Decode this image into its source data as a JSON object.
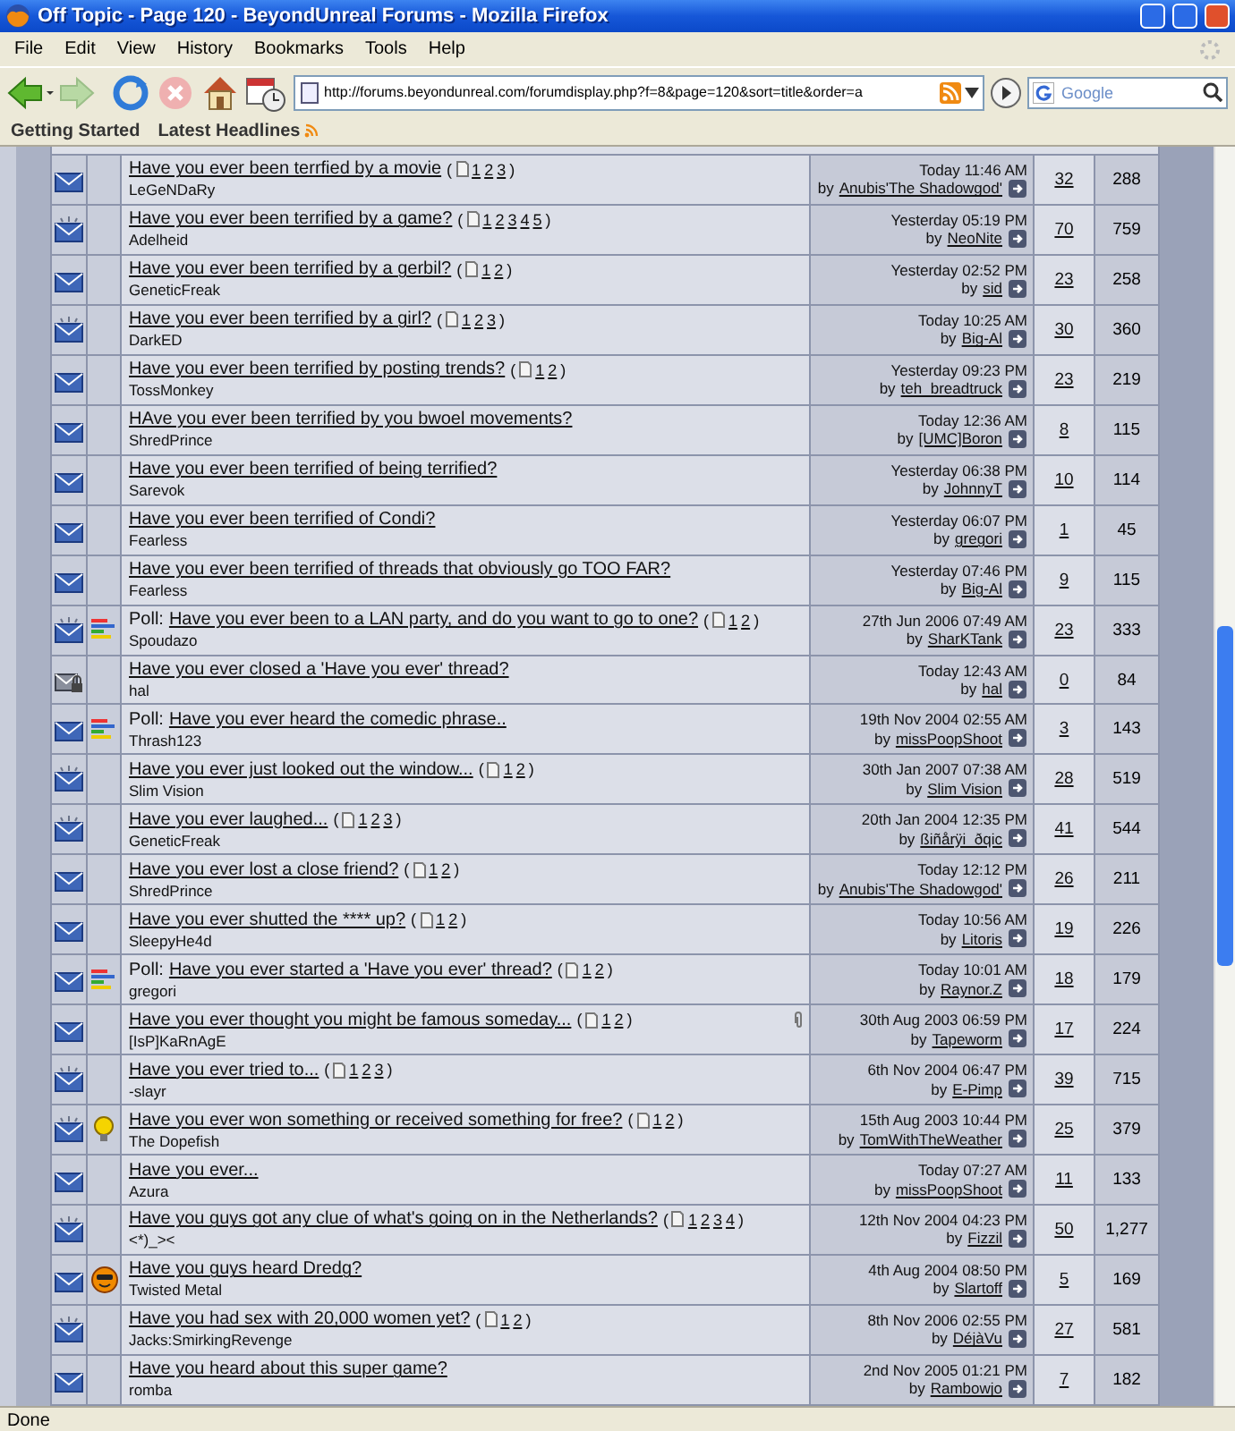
{
  "window": {
    "title": "Off Topic - Page 120 - BeyondUnreal Forums - Mozilla Firefox"
  },
  "menu": [
    "File",
    "Edit",
    "View",
    "History",
    "Bookmarks",
    "Tools",
    "Help"
  ],
  "toolbar": {
    "forward_enabled": false,
    "stop_enabled": false
  },
  "address": {
    "value": "http://forums.beyondunreal.com/forumdisplay.php?f=8&page=120&sort=title&order=a"
  },
  "search": {
    "placeholder": "Google"
  },
  "bookmarks": [
    {
      "label": "Getting Started",
      "kind": "link"
    },
    {
      "label": "Latest Headlines",
      "kind": "feed"
    }
  ],
  "threads": [
    {
      "status": {
        "kind": "normal"
      },
      "title": "Have you ever been terrfied by a movie",
      "pages": {
        "open": "(",
        "numbers": [
          "1",
          "2",
          "3"
        ],
        "close": ")"
      },
      "attachment": false,
      "starter": "LeGeNDaRy",
      "date": "Today 11:46 AM",
      "by": "by",
      "last_poster": "Anubis'The Shadowgod'",
      "replies": "32",
      "views": "288"
    },
    {
      "status": {
        "kind": "hot"
      },
      "title": "Have you ever been terrified by a game?",
      "pages": {
        "open": "(",
        "numbers": [
          "1",
          "2",
          "3",
          "4",
          "5"
        ],
        "close": ")"
      },
      "attachment": false,
      "starter": "Adelheid",
      "date": "Yesterday 05:19 PM",
      "by": "by",
      "last_poster": "NeoNite",
      "replies": "70",
      "views": "759"
    },
    {
      "status": {
        "kind": "normal"
      },
      "title": "Have you ever been terrified by a gerbil?",
      "pages": {
        "open": "(",
        "numbers": [
          "1",
          "2"
        ],
        "close": ")"
      },
      "attachment": false,
      "starter": "GeneticFreak",
      "date": "Yesterday 02:52 PM",
      "by": "by",
      "last_poster": "sid",
      "replies": "23",
      "views": "258"
    },
    {
      "status": {
        "kind": "hot"
      },
      "title": "Have you ever been terrified by a girl?",
      "pages": {
        "open": "(",
        "numbers": [
          "1",
          "2",
          "3"
        ],
        "close": ")"
      },
      "attachment": false,
      "starter": "DarkED",
      "date": "Today 10:25 AM",
      "by": "by",
      "last_poster": "Big-Al",
      "replies": "30",
      "views": "360"
    },
    {
      "status": {
        "kind": "normal"
      },
      "title": "Have you ever been terrified by posting trends?",
      "pages": {
        "open": "(",
        "numbers": [
          "1",
          "2"
        ],
        "close": ")"
      },
      "attachment": false,
      "starter": "TossMonkey",
      "date": "Yesterday 09:23 PM",
      "by": "by",
      "last_poster": "teh_breadtruck",
      "replies": "23",
      "views": "219"
    },
    {
      "status": {
        "kind": "normal"
      },
      "title": "HAve you ever been terrified by you bwoel movements?",
      "attachment": false,
      "starter": "ShredPrince",
      "date": "Today 12:36 AM",
      "by": "by",
      "last_poster": "[UMC]Boron",
      "replies": "8",
      "views": "115"
    },
    {
      "status": {
        "kind": "normal"
      },
      "title": "Have you ever been terrified of being terrified?",
      "attachment": false,
      "starter": "Sarevok",
      "date": "Yesterday 06:38 PM",
      "by": "by",
      "last_poster": "JohnnyT",
      "replies": "10",
      "views": "114"
    },
    {
      "status": {
        "kind": "normal"
      },
      "title": "Have you ever been terrified of Condi?",
      "attachment": false,
      "starter": "Fearless",
      "date": "Yesterday 06:07 PM",
      "by": "by",
      "last_poster": "gregori",
      "replies": "1",
      "views": "45"
    },
    {
      "status": {
        "kind": "normal"
      },
      "title": "Have you ever been terrified of threads that obviously go TOO FAR?",
      "attachment": false,
      "starter": "Fearless",
      "date": "Yesterday 07:46 PM",
      "by": "by",
      "last_poster": "Big-Al",
      "replies": "9",
      "views": "115"
    },
    {
      "status": {
        "kind": "hot"
      },
      "post_icon": {
        "kind": "poll"
      },
      "prefix": "Poll:",
      "title": "Have you ever been to a LAN party, and do you want to go to one?",
      "pages": {
        "open": "(",
        "numbers": [
          "1",
          "2"
        ],
        "close": ")"
      },
      "attachment": false,
      "starter": "Spoudazo",
      "date": "27th Jun 2006 07:49 AM",
      "by": "by",
      "last_poster": "SharKTank",
      "replies": "23",
      "views": "333"
    },
    {
      "status": {
        "kind": "locked"
      },
      "title": "Have you ever closed a 'Have you ever' thread?",
      "attachment": false,
      "starter": "hal",
      "date": "Today 12:43 AM",
      "by": "by",
      "last_poster": "hal",
      "replies": "0",
      "views": "84"
    },
    {
      "status": {
        "kind": "normal"
      },
      "post_icon": {
        "kind": "poll"
      },
      "prefix": "Poll:",
      "title": "Have you ever heard the comedic phrase..",
      "attachment": false,
      "starter": "Thrash123",
      "date": "19th Nov 2004 02:55 AM",
      "by": "by",
      "last_poster": "missPoopShoot",
      "replies": "3",
      "views": "143"
    },
    {
      "status": {
        "kind": "hot"
      },
      "title": "Have you ever just looked out the window...",
      "pages": {
        "open": "(",
        "numbers": [
          "1",
          "2"
        ],
        "close": ")"
      },
      "attachment": false,
      "starter": "Slim Vision",
      "date": "30th Jan 2007 07:38 AM",
      "by": "by",
      "last_poster": "Slim Vision",
      "replies": "28",
      "views": "519"
    },
    {
      "status": {
        "kind": "hot"
      },
      "title": "Have you ever laughed...",
      "pages": {
        "open": "(",
        "numbers": [
          "1",
          "2",
          "3"
        ],
        "close": ")"
      },
      "attachment": false,
      "starter": "GeneticFreak",
      "date": "20th Jan 2004 12:35 PM",
      "by": "by",
      "last_poster": "ßiñårÿi_ðqic",
      "replies": "41",
      "views": "544"
    },
    {
      "status": {
        "kind": "normal"
      },
      "title": "Have you ever lost a close friend?",
      "pages": {
        "open": "(",
        "numbers": [
          "1",
          "2"
        ],
        "close": ")"
      },
      "attachment": false,
      "starter": "ShredPrince",
      "date": "Today 12:12 PM",
      "by": "by",
      "last_poster": "Anubis'The Shadowgod'",
      "replies": "26",
      "views": "211"
    },
    {
      "status": {
        "kind": "normal"
      },
      "title": "Have you ever shutted the **** up?",
      "pages": {
        "open": "(",
        "numbers": [
          "1",
          "2"
        ],
        "close": ")"
      },
      "attachment": false,
      "starter": "SleepyHe4d",
      "date": "Today 10:56 AM",
      "by": "by",
      "last_poster": "Litoris",
      "replies": "19",
      "views": "226"
    },
    {
      "status": {
        "kind": "normal"
      },
      "post_icon": {
        "kind": "poll"
      },
      "prefix": "Poll:",
      "title": "Have you ever started a 'Have you ever' thread?",
      "pages": {
        "open": "(",
        "numbers": [
          "1",
          "2"
        ],
        "close": ")"
      },
      "attachment": false,
      "starter": "gregori",
      "date": "Today 10:01 AM",
      "by": "by",
      "last_poster": "Raynor.Z",
      "replies": "18",
      "views": "179"
    },
    {
      "status": {
        "kind": "normal"
      },
      "title": "Have you ever thought you might be famous someday...",
      "pages": {
        "open": "(",
        "numbers": [
          "1",
          "2"
        ],
        "close": ")"
      },
      "attachment": true,
      "starter": "[IsP]KaRnAgE",
      "date": "30th Aug 2003 06:59 PM",
      "by": "by",
      "last_poster": "Tapeworm",
      "replies": "17",
      "views": "224"
    },
    {
      "status": {
        "kind": "hot"
      },
      "title": "Have you ever tried to...",
      "pages": {
        "open": "(",
        "numbers": [
          "1",
          "2",
          "3"
        ],
        "close": ")"
      },
      "attachment": false,
      "starter": "-slayr",
      "date": "6th Nov 2004 06:47 PM",
      "by": "by",
      "last_poster": "E-Pimp",
      "replies": "39",
      "views": "715"
    },
    {
      "status": {
        "kind": "hot"
      },
      "post_icon": {
        "kind": "lightbulb"
      },
      "title": "Have you ever won something or received something for free?",
      "pages": {
        "open": "(",
        "numbers": [
          "1",
          "2"
        ],
        "close": ")"
      },
      "attachment": false,
      "starter": "The Dopefish",
      "date": "15th Aug 2003 10:44 PM",
      "by": "by",
      "last_poster": "TomWithTheWeather",
      "replies": "25",
      "views": "379"
    },
    {
      "status": {
        "kind": "normal"
      },
      "title": "Have you ever...",
      "attachment": false,
      "starter": "Azura",
      "date": "Today 07:27 AM",
      "by": "by",
      "last_poster": "missPoopShoot",
      "replies": "11",
      "views": "133"
    },
    {
      "status": {
        "kind": "hot"
      },
      "title": "Have you guys got any clue of what's going on in the Netherlands?",
      "pages": {
        "open": "(",
        "numbers": [
          "1",
          "2",
          "3",
          "4"
        ],
        "close": ")"
      },
      "attachment": false,
      "starter": "<*)_><",
      "date": "12th Nov 2004 04:23 PM",
      "by": "by",
      "last_poster": "Fizzil",
      "replies": "50",
      "views": "1,277"
    },
    {
      "status": {
        "kind": "normal"
      },
      "post_icon": {
        "kind": "smiley"
      },
      "title": "Have you guys heard Dredg?",
      "attachment": false,
      "starter": "Twisted Metal",
      "date": "4th Aug 2004 08:50 PM",
      "by": "by",
      "last_poster": "Slartoff",
      "replies": "5",
      "views": "169"
    },
    {
      "status": {
        "kind": "hot"
      },
      "title": "Have you had sex with 20,000 women yet?",
      "pages": {
        "open": "(",
        "numbers": [
          "1",
          "2"
        ],
        "close": ")"
      },
      "attachment": false,
      "starter": "Jacks:SmirkingRevenge",
      "date": "8th Nov 2006 02:55 PM",
      "by": "by",
      "last_poster": "DéjàVu",
      "replies": "27",
      "views": "581"
    },
    {
      "status": {
        "kind": "normal"
      },
      "title": "Have you heard about this super game?",
      "attachment": false,
      "starter": "romba",
      "date": "2nd Nov 2005 01:21 PM",
      "by": "by",
      "last_poster": "Rambowjo",
      "replies": "7",
      "views": "182"
    }
  ],
  "status_bar": "Done"
}
